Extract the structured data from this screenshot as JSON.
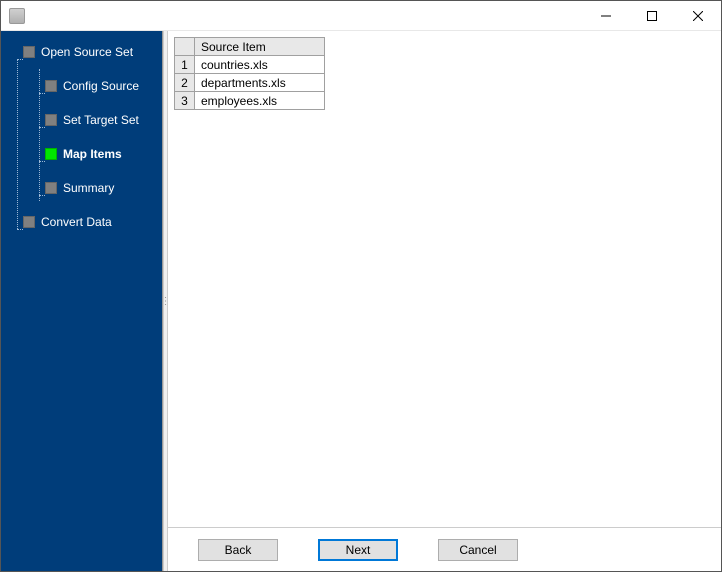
{
  "window": {
    "title": ""
  },
  "sidebar": {
    "items": [
      {
        "label": "Open Source Set",
        "active": false
      },
      {
        "label": "Config Source",
        "active": false
      },
      {
        "label": "Set Target Set",
        "active": false
      },
      {
        "label": "Map Items",
        "active": true
      },
      {
        "label": "Summary",
        "active": false
      },
      {
        "label": "Convert Data",
        "active": false
      }
    ]
  },
  "grid": {
    "header": "Source Item",
    "rows": [
      {
        "num": "1",
        "value": "countries.xls"
      },
      {
        "num": "2",
        "value": "departments.xls"
      },
      {
        "num": "3",
        "value": "employees.xls"
      }
    ]
  },
  "buttons": {
    "back": "Back",
    "next": "Next",
    "cancel": "Cancel"
  }
}
